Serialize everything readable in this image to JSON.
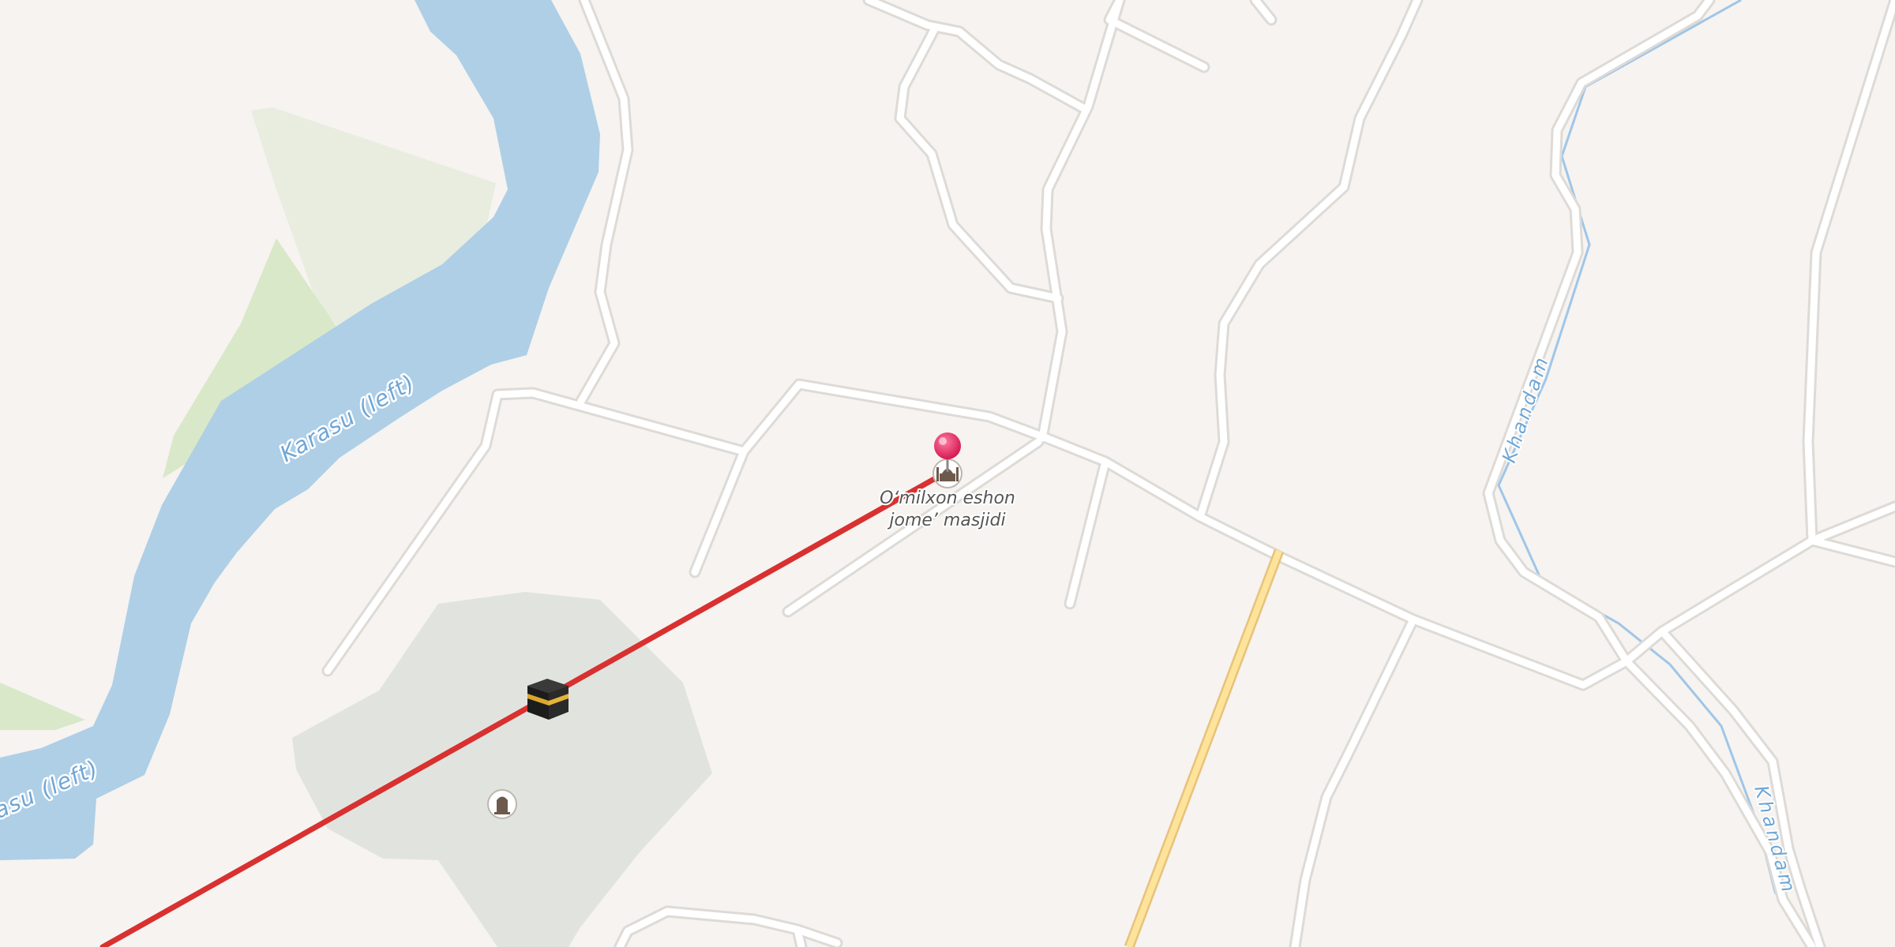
{
  "map": {
    "colors": {
      "background": "#f6f3f0",
      "water": "#aecfe6",
      "water_label": "#6fa6d6",
      "park": "#e8eddf",
      "grass": "#d9e8c8",
      "cemetery": "#e1e4de",
      "road": "#ffffff",
      "road_casing": "#dedad6",
      "highway": "#fde49a",
      "highway_casing": "#e8c27a",
      "route": "#d93030",
      "pin": "#e8245f"
    },
    "labels": {
      "river_upper": "Karasu (left)",
      "river_lower": "Karasu (left)",
      "stream_upper": "Khandam",
      "stream_lower": "Khandam"
    },
    "poi": {
      "mosque_line1": "O‘milxon eshon",
      "mosque_line2": "jome’ masjidi",
      "mosque_icon": "mosque-icon",
      "kaaba_icon": "kaaba-icon",
      "cemetery_icon": "cemetery-icon",
      "pin_icon": "location-pin-icon"
    }
  }
}
